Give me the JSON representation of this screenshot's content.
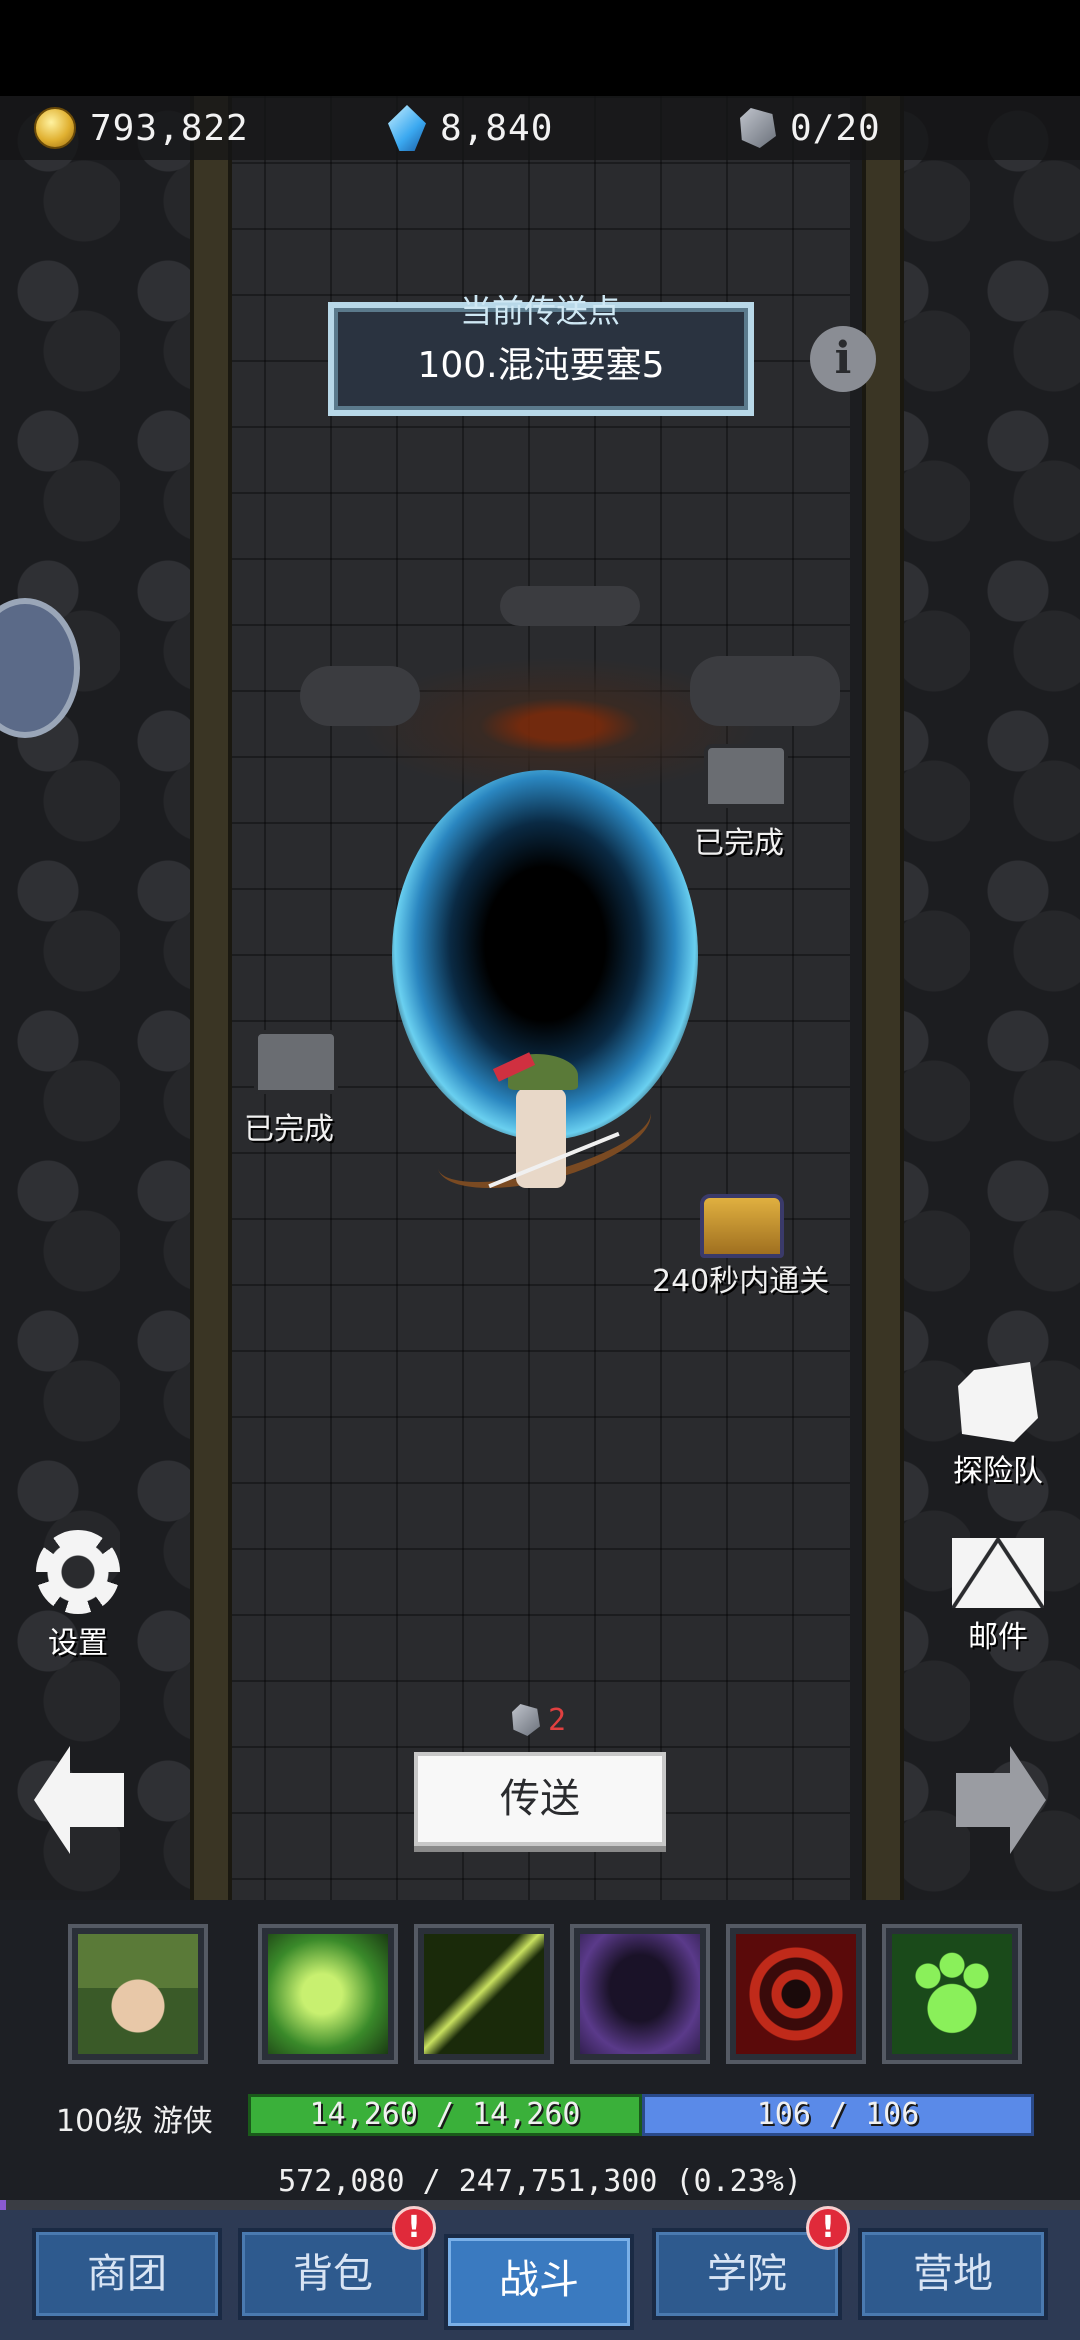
{
  "currencies": {
    "gold": "793,822",
    "gems": "8,840",
    "stones": "0/20"
  },
  "teleport_point": {
    "title": "当前传送点",
    "value": "100.混沌要塞5"
  },
  "info_button": "i",
  "chests": [
    {
      "label": "已完成",
      "state": "empty"
    },
    {
      "label": "已完成",
      "state": "empty"
    },
    {
      "label": "240秒内通关",
      "state": "gold"
    }
  ],
  "side_buttons": {
    "expedition": "探险队",
    "mail": "邮件",
    "settings": "设置"
  },
  "teleport": {
    "cost": "2",
    "button_label": "传送"
  },
  "hero": {
    "level_class": "100级 游侠",
    "hp": "14,260 / 14,260",
    "mp": "106 / 106",
    "exp": "572,080 / 247,751,300 (0.23%)",
    "exp_fraction": 0.0023
  },
  "skills": [
    {
      "name": "hero-portrait-icon",
      "color": "#5a7a38"
    },
    {
      "name": "bow-skill-icon",
      "color": "#3a8a2a"
    },
    {
      "name": "arrow-skill-icon",
      "color": "#4a6a1a"
    },
    {
      "name": "hooded-assassin-icon",
      "color": "#3a2a5a"
    },
    {
      "name": "target-skill-icon",
      "color": "#8a1a1a"
    },
    {
      "name": "paw-skill-icon",
      "color": "#2a6a2a"
    }
  ],
  "nav": {
    "tabs": [
      "商团",
      "背包",
      "战斗",
      "学院",
      "营地"
    ],
    "active": "战斗",
    "badge": "!"
  }
}
